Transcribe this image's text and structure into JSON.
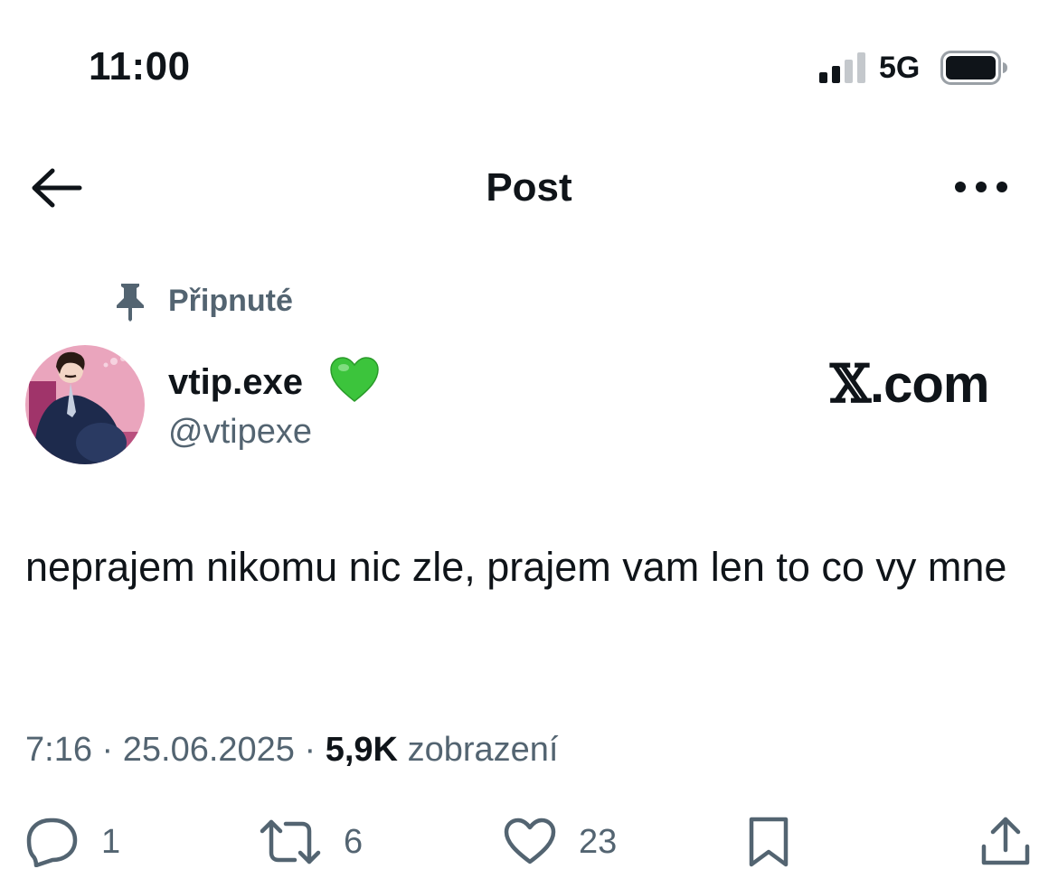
{
  "status_bar": {
    "time": "11:00",
    "network": "5G",
    "signal_icon": "signal-bars-icon",
    "battery_icon": "battery-icon"
  },
  "nav": {
    "back_icon": "arrow-left-icon",
    "title": "Post",
    "more_icon": "more-horizontal-icon"
  },
  "post": {
    "pinned_label": "Připnuté",
    "author": {
      "display_name": "vtip.exe",
      "badge_emoji": "💚",
      "handle": "@vtipexe"
    },
    "watermark": {
      "logo": "𝕏",
      "text": ".com"
    },
    "text": "neprajem nikomu nic zle, prajem vam len to co vy mne",
    "meta": {
      "time": "7:16",
      "separator": "·",
      "date": "25.06.2025",
      "views_count": "5,9K",
      "views_label": "zobrazení"
    },
    "actions": {
      "replies": "1",
      "reposts": "6",
      "likes": "23"
    }
  },
  "colors": {
    "text_primary": "#0f1419",
    "text_secondary": "#536471",
    "heart_green": "#3cc43c"
  }
}
